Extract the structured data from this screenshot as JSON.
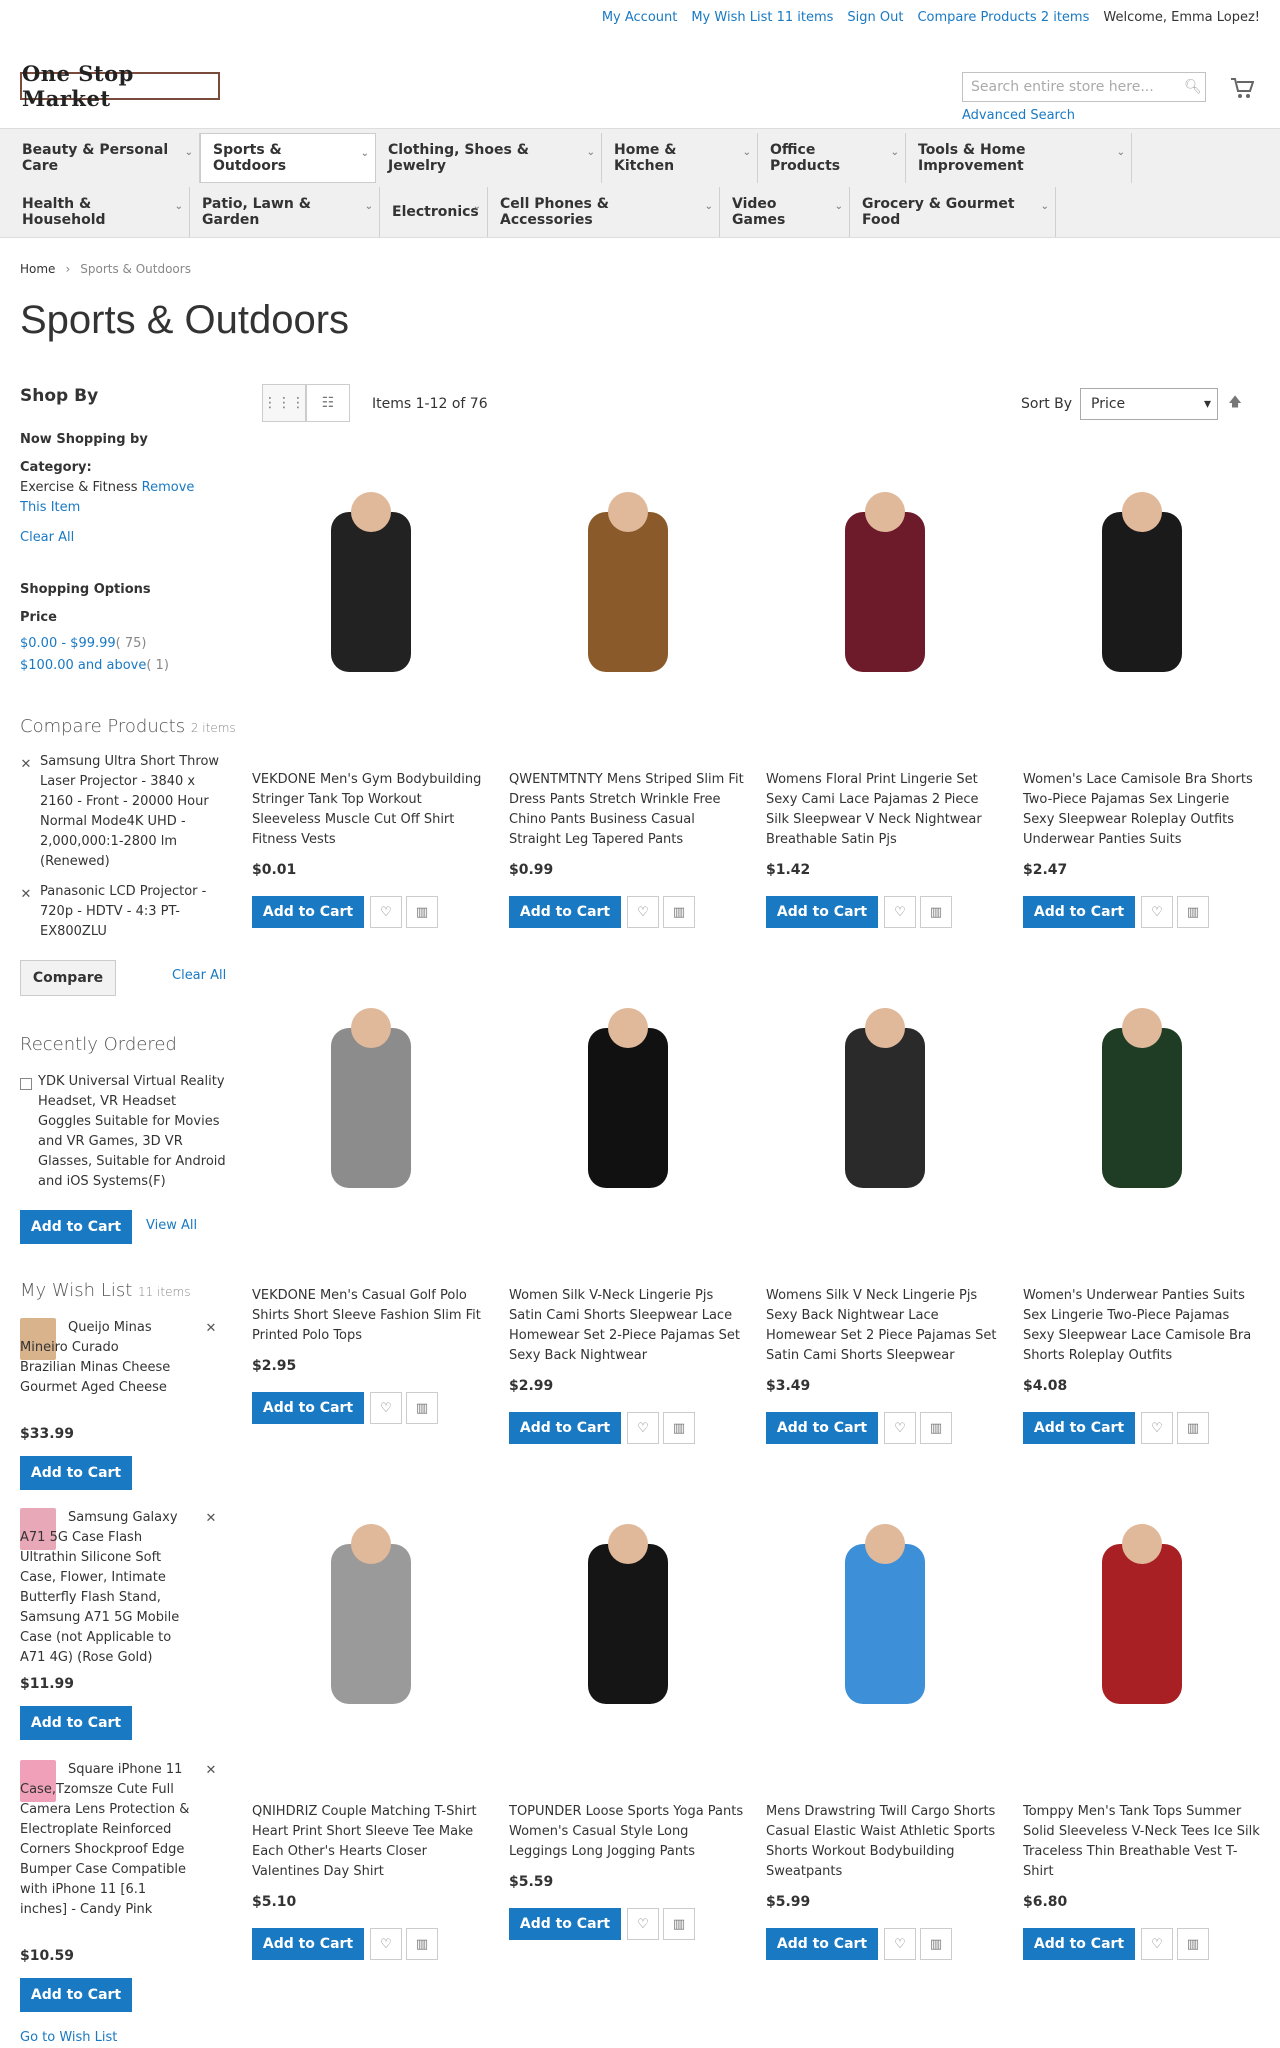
{
  "header": {
    "links": [
      "My Account",
      "My Wish List 11 items",
      "Sign Out",
      "Compare Products 2 items"
    ],
    "welcome": "Welcome, Emma Lopez!",
    "logo": "One Stop Market",
    "search_placeholder": "Search entire store here...",
    "advanced_search": "Advanced Search"
  },
  "nav": {
    "row1": [
      "Beauty & Personal Care",
      "Sports & Outdoors",
      "Clothing, Shoes & Jewelry",
      "Home & Kitchen",
      "Office Products",
      "Tools & Home Improvement"
    ],
    "row2": [
      "Health & Household",
      "Patio, Lawn & Garden",
      "Electronics",
      "Cell Phones & Accessories",
      "Video Games",
      "Grocery & Gourmet Food"
    ]
  },
  "breadcrumb": {
    "home": "Home",
    "current": "Sports & Outdoors"
  },
  "page_title": "Sports & Outdoors",
  "sidebar": {
    "shop_by": "Shop By",
    "now_shopping": "Now Shopping by",
    "category_label": "Category:",
    "category_value": "Exercise & Fitness",
    "remove": "Remove This Item",
    "clear_all": "Clear All",
    "shopping_options": "Shopping Options",
    "price_label": "Price",
    "price_options": [
      {
        "label": "$0.00 - $99.99",
        "count": "( 75)"
      },
      {
        "label": "$100.00 and above",
        "count": "( 1)"
      }
    ],
    "compare": {
      "title": "Compare Products",
      "count": "2 items",
      "items": [
        "Samsung Ultra Short Throw Laser Projector - 3840 x 2160 - Front - 20000 Hour Normal Mode4K UHD - 2,000,000:1-2800 lm (Renewed)",
        "Panasonic LCD Projector - 720p - HDTV - 4:3 PT-EX800ZLU"
      ],
      "compare_btn": "Compare",
      "clear_all": "Clear All"
    },
    "recent": {
      "title": "Recently Ordered",
      "item": "YDK Universal Virtual Reality Headset, VR Headset Goggles Suitable for Movies and VR Games, 3D VR Glasses, Suitable for Android and iOS Systems(F)",
      "add_to_cart": "Add to Cart",
      "view_all": "View All"
    },
    "wishlist": {
      "title": "My Wish List",
      "count": "11 items",
      "items": [
        {
          "name": "Queijo Minas Mineiro Curado Brazilian Minas Cheese Gourmet Aged Cheese",
          "price": "$33.99"
        },
        {
          "name": "Samsung Galaxy A71 5G Case Flash Ultrathin Silicone Soft Case, Flower, Intimate Butterfly Flash Stand, Samsung A71 5G Mobile Case (not Applicable to A71 4G) (Rose Gold)",
          "price": "$11.99"
        },
        {
          "name": "Square iPhone 11 Case,Tzomsze Cute Full Camera Lens Protection & Electroplate Reinforced Corners Shockproof Edge Bumper Case Compatible with iPhone 11 [6.1 inches] - Candy Pink",
          "price": "$10.59"
        }
      ],
      "add_to_cart": "Add to Cart",
      "go_to": "Go to Wish List"
    }
  },
  "toolbar": {
    "amount": "Items 1-12 of 76",
    "sort_label": "Sort By",
    "sort_value": "Price"
  },
  "product_add_label": "Add to Cart",
  "products": [
    {
      "name": "VEKDONE Men's Gym Bodybuilding Stringer Tank Top Workout Sleeveless Muscle Cut Off Shirt Fitness Vests",
      "price": "$0.01",
      "color": "#222222"
    },
    {
      "name": "QWENTMTNTY Mens Striped Slim Fit Dress Pants Stretch Wrinkle Free Chino Pants Business Casual Straight Leg Tapered Pants",
      "price": "$0.99",
      "color": "#8a5a2a"
    },
    {
      "name": "Womens Floral Print Lingerie Set Sexy Cami Lace Pajamas 2 Piece Silk Sleepwear V Neck Nightwear Breathable Satin Pjs",
      "price": "$1.42",
      "color": "#6d1a2a"
    },
    {
      "name": "Women's Lace Camisole Bra Shorts Two-Piece Pajamas Sex Lingerie Sexy Sleepwear Roleplay Outfits Underwear Panties Suits",
      "price": "$2.47",
      "color": "#1a1a1a"
    },
    {
      "name": "VEKDONE Men's Casual Golf Polo Shirts Short Sleeve Fashion Slim Fit Printed Polo Tops",
      "price": "$2.95",
      "color": "#8c8c8c"
    },
    {
      "name": "Women Silk V-Neck Lingerie Pjs Satin Cami Shorts Sleepwear Lace Homewear Set 2-Piece Pajamas Set Sexy Back Nightwear",
      "price": "$2.99",
      "color": "#111111"
    },
    {
      "name": "Womens Silk V Neck Lingerie Pjs Sexy Back Nightwear Lace Homewear Set 2 Piece Pajamas Set Satin Cami Shorts Sleepwear",
      "price": "$3.49",
      "color": "#2a2a2a"
    },
    {
      "name": "Women's Underwear Panties Suits Sex Lingerie Two-Piece Pajamas Sexy Sleepwear Lace Camisole Bra Shorts Roleplay Outfits",
      "price": "$4.08",
      "color": "#1f3d24"
    },
    {
      "name": "QNIHDRIZ Couple Matching T-Shirt Heart Print Short Sleeve Tee Make Each Other's Hearts Closer Valentines Day Shirt",
      "price": "$5.10",
      "color": "#9a9a9a"
    },
    {
      "name": "TOPUNDER Loose Sports Yoga Pants Women's Casual Style Long Leggings Long Jogging Pants",
      "price": "$5.59",
      "color": "#151515"
    },
    {
      "name": "Mens Drawstring Twill Cargo Shorts Casual Elastic Waist Athletic Sports Shorts Workout Bodybuilding Sweatpants",
      "price": "$5.99",
      "color": "#3d8fd8"
    },
    {
      "name": "Tomppy Men's Tank Tops Summer Solid Sleeveless V-Neck Tees Ice Silk Traceless Thin Breathable Vest T-Shirt",
      "price": "$6.80",
      "color": "#a81f24"
    }
  ]
}
